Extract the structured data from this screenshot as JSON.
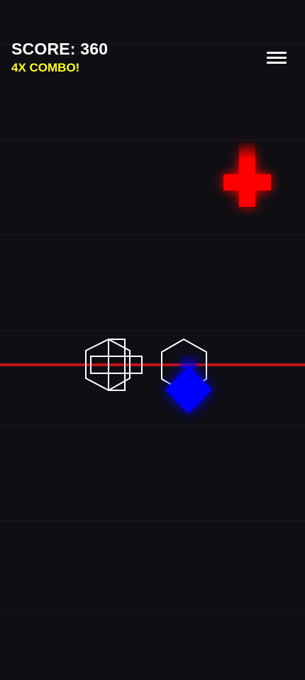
{
  "hud": {
    "score_text": "SCORE: 360",
    "combo_text": "4X COMBO!"
  },
  "colors": {
    "background": "#0e0e13",
    "score": "#ffffff",
    "combo": "#ffff1a",
    "hit_line": "#c1121a",
    "falling_cross": "#ff0000",
    "falling_diamond": "#0000ff",
    "target_outline": "#ffffff"
  },
  "menu": {
    "icon": "hamburger-menu-icon"
  },
  "pieces": {
    "falling": [
      {
        "name": "falling-red-cross",
        "shape": "cross",
        "color": "red"
      },
      {
        "name": "falling-blue-diamond",
        "shape": "diamond",
        "color": "blue"
      }
    ],
    "targets": [
      {
        "name": "target-combined-outline",
        "shape": "hexagon-with-cross"
      },
      {
        "name": "target-hexagon-outline",
        "shape": "hexagon"
      }
    ]
  }
}
